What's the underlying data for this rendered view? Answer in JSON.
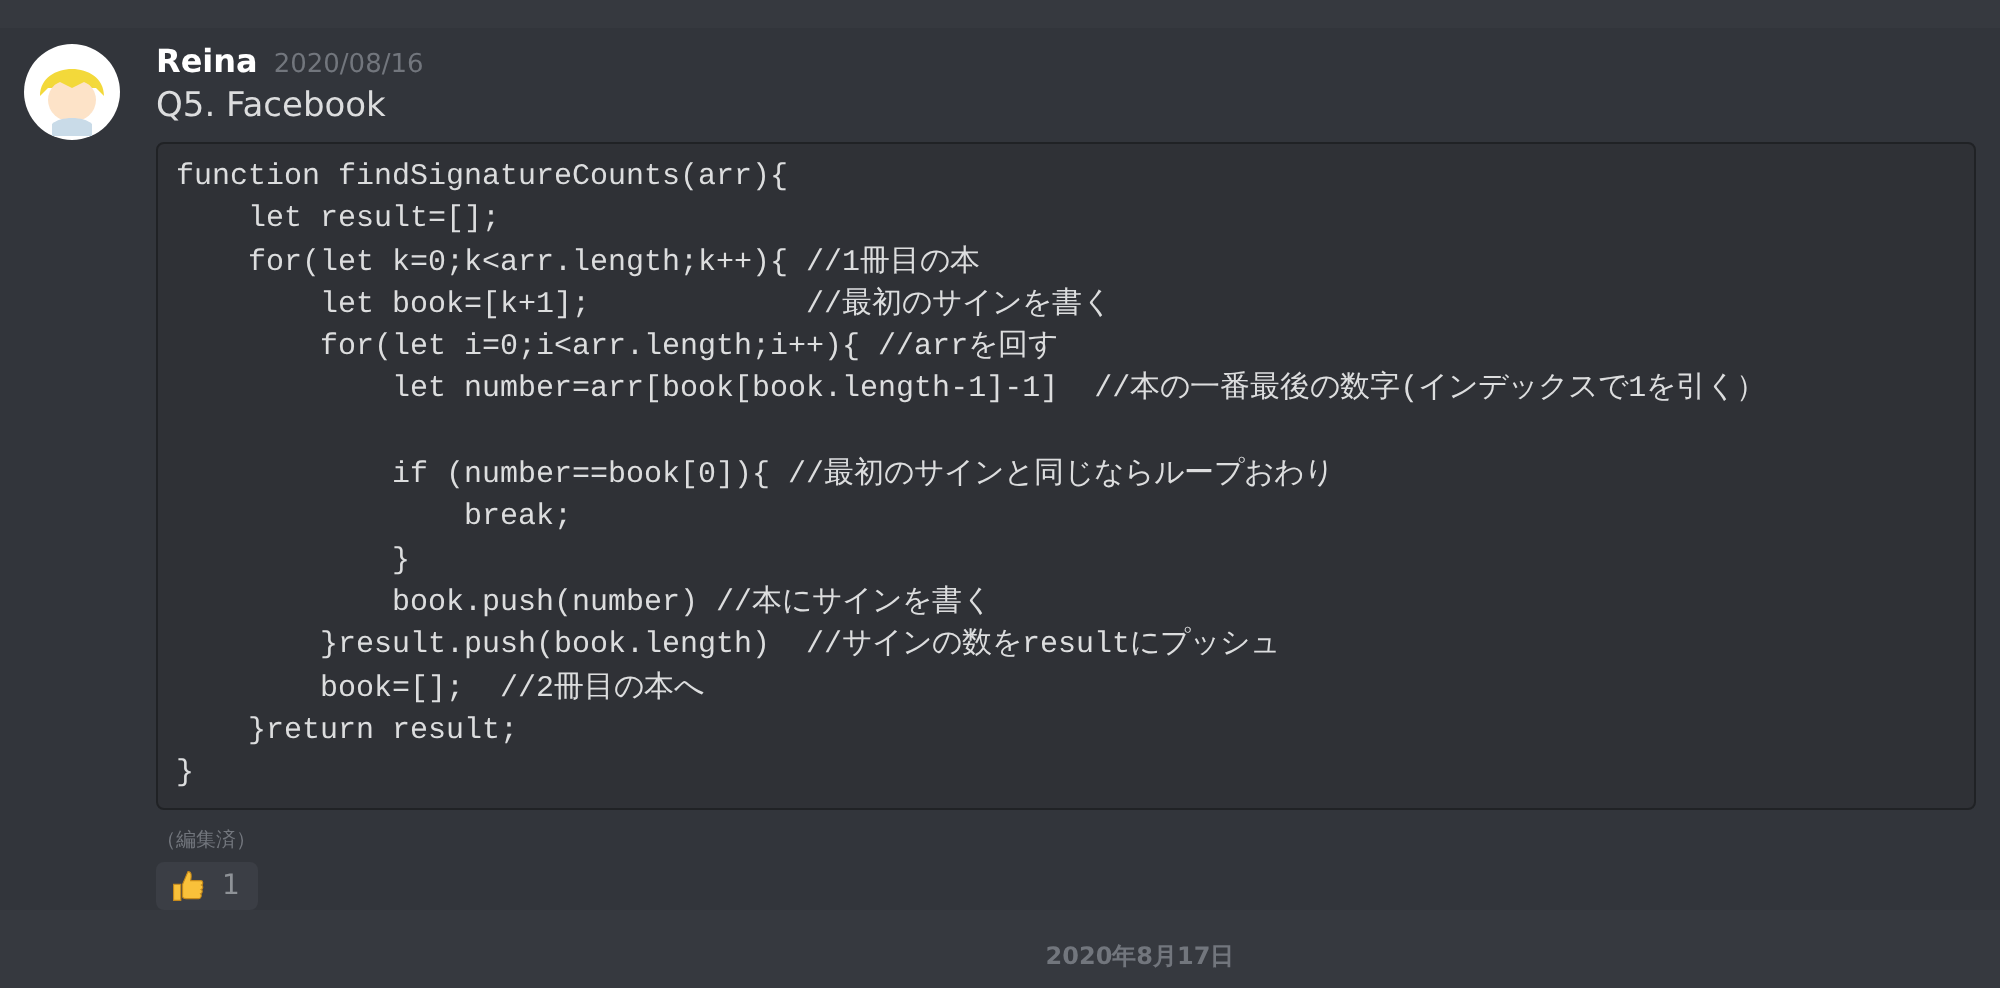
{
  "message": {
    "author": "Reina",
    "timestamp": "2020/08/16",
    "text": "Q5. Facebook",
    "code_lines": [
      {
        "text": "function findSignatureCounts(arr){",
        "blank_line_before": false
      },
      {
        "text": "    let result=[];",
        "blank_line_before": false
      },
      {
        "text": "    for(let k=0;k<arr.length;k++){ //1冊目の本",
        "blank_line_before": false
      },
      {
        "text": "        let book=[k+1];            //最初のサインを書く",
        "blank_line_before": false
      },
      {
        "text": "        for(let i=0;i<arr.length;i++){ //arrを回す",
        "blank_line_before": false
      },
      {
        "text": "            let number=arr[book[book.length-1]-1]  //本の一番最後の数字(インデックスで1を引く）",
        "blank_line_before": false
      },
      {
        "text": "            if (number==book[0]){ //最初のサインと同じならループおわり",
        "blank_line_before": true
      },
      {
        "text": "                break;",
        "blank_line_before": false
      },
      {
        "text": "            }",
        "blank_line_before": false
      },
      {
        "text": "            book.push(number) //本にサインを書く",
        "blank_line_before": false
      },
      {
        "text": "        }result.push(book.length)  //サインの数をresultにプッシュ",
        "blank_line_before": false
      },
      {
        "text": "        book=[];  //2冊目の本へ",
        "blank_line_before": false
      },
      {
        "text": "    }return result;",
        "blank_line_before": false
      },
      {
        "text": "}",
        "blank_line_before": false
      }
    ],
    "edited": "（編集済）",
    "reactions": [
      {
        "count": "1",
        "selected": false
      }
    ]
  },
  "date_divider": "2020年8月17日"
}
